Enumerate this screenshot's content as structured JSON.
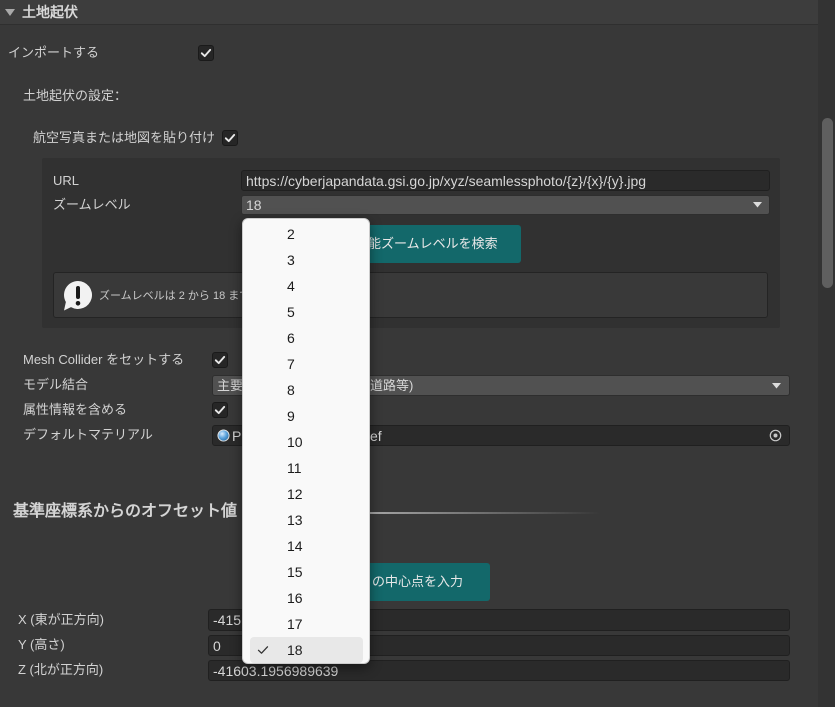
{
  "header": {
    "title": "土地起伏"
  },
  "import": {
    "label": "インポートする",
    "checked": true
  },
  "terrain": {
    "settings_label": "土地起伏の設定：",
    "paste_map": {
      "label": "航空写真または地図を貼り付け",
      "checked": true
    },
    "url": {
      "label": "URL",
      "value": "https://cyberjapandata.gsi.go.jp/xyz/seamlessphoto/{z}/{x}/{y}.jpg"
    },
    "zoom": {
      "label": "ズームレベル",
      "value": "18"
    },
    "search_button_label": "能ズームレベルを検索",
    "help_text": "ズームレベルは 2 から 18 まで"
  },
  "mesh_collider": {
    "label": "Mesh Collider をセットする",
    "checked": true
  },
  "model_merge": {
    "label": "モデル結合",
    "value_left": "主要",
    "value_right": "道路等)"
  },
  "attributes": {
    "label": "属性情報を含める",
    "checked": true
  },
  "default_material": {
    "label": "デフォルトマテリアル",
    "value_left": "P",
    "value_right": "ef"
  },
  "offset": {
    "heading": "基準座標系からのオフセット値",
    "center_button_label": "の中心点を入力",
    "x": {
      "label": "X (東が正方向)",
      "value": "-415"
    },
    "y": {
      "label": "Y (高さ)",
      "value": "0"
    },
    "z": {
      "label": "Z (北が正方向)",
      "value": "-41603.1956989639"
    }
  },
  "zoom_popup": {
    "options": [
      {
        "label": "2"
      },
      {
        "label": "3"
      },
      {
        "label": "4"
      },
      {
        "label": "5"
      },
      {
        "label": "6"
      },
      {
        "label": "7"
      },
      {
        "label": "8"
      },
      {
        "label": "9"
      },
      {
        "label": "10"
      },
      {
        "label": "11"
      },
      {
        "label": "12"
      },
      {
        "label": "13"
      },
      {
        "label": "14"
      },
      {
        "label": "15"
      },
      {
        "label": "16"
      },
      {
        "label": "17"
      },
      {
        "label": "18",
        "selected": true
      }
    ]
  },
  "colors": {
    "background": "#383838",
    "header": "#3d3d3d",
    "accent_button": "#13686a",
    "popup": "#f9f9f9",
    "popup_selected": "#e8e8e8",
    "text": "#d2d2d2"
  },
  "icons": {
    "foldout": "triangle-down-icon",
    "toggle": "checkmark-icon",
    "dropdown": "dropdown-arrow-icon",
    "help": "warning-icon",
    "material": "material-sphere-icon",
    "picker": "object-picker-icon"
  }
}
